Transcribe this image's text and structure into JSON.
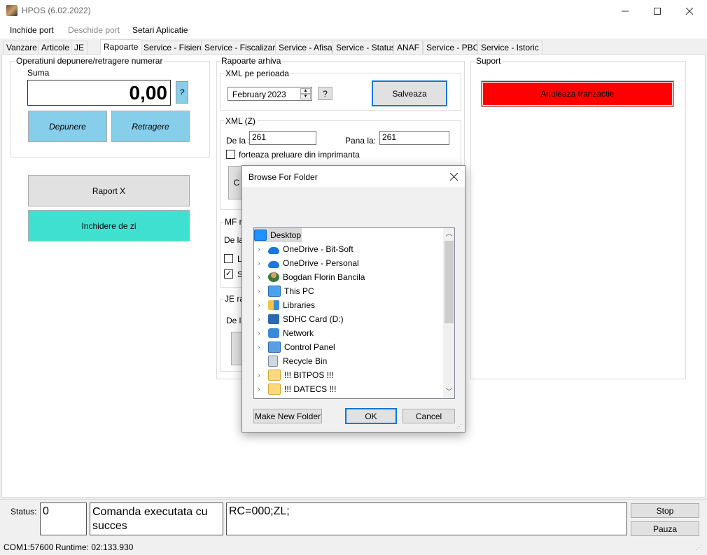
{
  "window": {
    "title": "HPOS (6.02.2022)"
  },
  "menu": {
    "close_port": "Inchide port",
    "open_port": "Deschide port",
    "settings": "Setari Aplicatie"
  },
  "tabs": [
    "Vanzare",
    "Articole",
    "JE",
    "Rapoarte",
    "Service - Fisiere",
    "Service - Fiscalizare",
    "Service - Afisaj",
    "Service - Status",
    "ANAF",
    "Service - PBC",
    "Service - Istoric"
  ],
  "active_tab": "Rapoarte",
  "cash_ops": {
    "group_title": "Operatiuni depunere/retragere numerar",
    "sum_label": "Suma",
    "amount": "0,00",
    "help": "?",
    "deposit": "Depunere",
    "withdraw": "Retragere"
  },
  "reports": {
    "x_report": "Raport X",
    "z_close": "Inchidere de zi"
  },
  "archive": {
    "group_title": "Rapoarte arhiva",
    "xml_period_title": "XML pe perioada",
    "month": "February",
    "year": "2023",
    "help": "?",
    "save": "Salveaza",
    "xml_z_title": "XML (Z)",
    "from_label": "De la :",
    "from_value": "261",
    "to_label": "Pana la:",
    "to_value": "261",
    "force_label": "forteaza preluare din imprimanta",
    "mf_title_partial": "MF ra",
    "mf_from_partial": "De la",
    "mf_check1_partial": "L",
    "mf_check2_partial": "S",
    "btn_partial": "C",
    "je_title_partial": "JE ra",
    "je_from_partial": "De la"
  },
  "support": {
    "group_title": "Suport",
    "cancel_tx": "Anuleaza tranzactie"
  },
  "dialog": {
    "title": "Browse For Folder",
    "items": [
      {
        "label": "Desktop",
        "icon": "desktop-icon",
        "expandable": false,
        "selected": true
      },
      {
        "label": "OneDrive - Bit-Soft",
        "icon": "cloud-icon",
        "expandable": true
      },
      {
        "label": "OneDrive - Personal",
        "icon": "cloud-icon",
        "expandable": true
      },
      {
        "label": "Bogdan Florin Bancila",
        "icon": "user-icon",
        "expandable": true
      },
      {
        "label": "This PC",
        "icon": "computer-icon",
        "expandable": true
      },
      {
        "label": "Libraries",
        "icon": "libraries-icon",
        "expandable": true
      },
      {
        "label": "SDHC Card (D:)",
        "icon": "sdcard-icon",
        "expandable": true
      },
      {
        "label": "Network",
        "icon": "network-icon",
        "expandable": true
      },
      {
        "label": "Control Panel",
        "icon": "control-panel-icon",
        "expandable": true
      },
      {
        "label": "Recycle Bin",
        "icon": "recycle-bin-icon",
        "expandable": false
      },
      {
        "label": "!!! BITPOS !!!",
        "icon": "folder-icon",
        "expandable": true
      },
      {
        "label": "!!! DATECS !!!",
        "icon": "folder-icon",
        "expandable": true
      }
    ],
    "new_folder": "Make New Folder",
    "ok": "OK",
    "cancel": "Cancel"
  },
  "status": {
    "label": "Status:",
    "code": "0",
    "message": "Comanda executata cu succes",
    "response": "RC=000;ZL;",
    "stop": "Stop",
    "pause": "Pauza"
  },
  "footer": {
    "port_info": "COM1:57600",
    "runtime": "Runtime: 02:133.930"
  },
  "colors": {
    "light_blue": "#87ceeb",
    "turquoise": "#40e0d0",
    "red": "#ff0000"
  }
}
